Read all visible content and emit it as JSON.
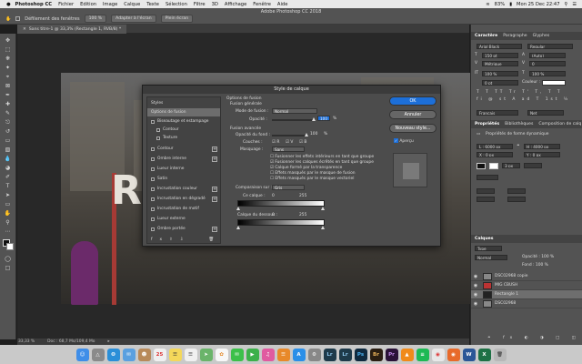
{
  "menubar": {
    "app": "Photoshop CC",
    "items": [
      "Fichier",
      "Edition",
      "Image",
      "Calque",
      "Texte",
      "Sélection",
      "Filtre",
      "3D",
      "Affichage",
      "Fenêtre",
      "Aide"
    ],
    "battery": "83%",
    "datetime": "Mon 25 Dec 22:47"
  },
  "optbar": {
    "window_title": "Adobe Photoshop CC 2018",
    "scroll_all_label": "Défilement des fenêtres",
    "zoom_value": "100 %",
    "fit_screen_label": "Adapter à l'écran",
    "full_screen_label": "Plein écran"
  },
  "document": {
    "tab_label": "Sans titre-1 @ 33,3% (Rectangle 1, RVB/8) *",
    "canvas_letter": "R"
  },
  "statusbar": {
    "zoom": "33,33 %",
    "doc_info": "Doc : 68,7 Mo/109,4 Mo"
  },
  "right_panel": {
    "tabs_top": [
      "Caractère",
      "Paragraphe",
      "Glyphes"
    ],
    "font_family": "Arial Black",
    "font_style": "Regular",
    "font_size": "150 pt",
    "leading": "(Auto)",
    "kerning": "Métrique",
    "tracking": "0",
    "scale_v": "100 %",
    "scale_h": "100 %",
    "baseline": "0 pt",
    "color_label": "Couleur :",
    "language": "Français",
    "aa_mode": "Net",
    "props_tabs": [
      "Propriétés",
      "Bibliothèques",
      "Composition de calq"
    ],
    "props_title": "Propriétés de forme dynamique",
    "width": "L : 6000 px",
    "height": "H : 4000 px",
    "x": "X : 0 px",
    "y": "Y : 0 px",
    "stroke": "3 px",
    "layers_title": "Calques",
    "layers_filter": "Type",
    "blend": "Normal",
    "opacity": "Opacité : 100 %",
    "fill": "Fond : 100 %",
    "layers": [
      {
        "name": "DSC02968 copie",
        "selected": false
      },
      {
        "name": "MIG CBUSH",
        "selected": false
      },
      {
        "name": "Rectangle 1",
        "selected": true
      },
      {
        "name": "DSC02968",
        "selected": false
      }
    ]
  },
  "dialog": {
    "title": "Style de calque",
    "styles_header": "Styles",
    "style_items": [
      {
        "label": "Options de fusion",
        "checkbox": false,
        "plus": false,
        "selected": true
      },
      {
        "label": "Biseautage et estampage",
        "checkbox": true,
        "plus": false,
        "selected": false
      },
      {
        "label": "Contour",
        "checkbox": true,
        "plus": false,
        "selected": false,
        "indent": true
      },
      {
        "label": "Texture",
        "checkbox": true,
        "plus": false,
        "selected": false,
        "indent": true
      },
      {
        "label": "Contour",
        "checkbox": true,
        "plus": true,
        "selected": false
      },
      {
        "label": "Ombre interne",
        "checkbox": true,
        "plus": true,
        "selected": false
      },
      {
        "label": "Lueur interne",
        "checkbox": true,
        "plus": false,
        "selected": false
      },
      {
        "label": "Satin",
        "checkbox": true,
        "plus": false,
        "selected": false
      },
      {
        "label": "Incrustation couleur",
        "checkbox": true,
        "plus": true,
        "selected": false
      },
      {
        "label": "Incrustation en dégradé",
        "checkbox": true,
        "plus": true,
        "selected": false
      },
      {
        "label": "Incrustation de motif",
        "checkbox": true,
        "plus": false,
        "selected": false
      },
      {
        "label": "Lueur externe",
        "checkbox": true,
        "plus": false,
        "selected": false
      },
      {
        "label": "Ombre portée",
        "checkbox": true,
        "plus": true,
        "selected": false
      }
    ],
    "fx_label": "fx",
    "section_blend": "Options de fusion",
    "section_general": "Fusion générale",
    "blend_mode_label": "Mode de fusion :",
    "blend_mode_value": "Normal",
    "opacity_label": "Opacité :",
    "opacity_value": "100",
    "opacity_fraction": 1.0,
    "percent": "%",
    "section_advanced": "Fusion avancée",
    "fill_opacity_label": "Opacité du fond :",
    "fill_opacity_value": "100",
    "channels_label": "Couches :",
    "channel_r": "R",
    "channel_g": "V",
    "channel_b": "B",
    "knockout_label": "Masquage :",
    "knockout_value": "Sans",
    "adv_options": [
      "Fusionner les effets intérieurs en tant que groupe",
      "Fusionner les calques écrêtés en tant que groupe",
      "Calque formé par la transparence",
      "Effets masqués par le masque de fusion",
      "Effets masqués par le masque vectoriel"
    ],
    "blend_if_label": "Comparaison sur :",
    "blend_if_value": "Gris",
    "this_layer_label": "Ce calque :",
    "this_layer_min": "0",
    "this_layer_max": "255",
    "underlying_label": "Calque du dessous :",
    "underlying_min": "0",
    "underlying_max": "255",
    "ok_label": "OK",
    "cancel_label": "Annuler",
    "new_style_label": "Nouveau style...",
    "preview_label": "Aperçu"
  },
  "dock_icons": [
    "finder-icon",
    "launchpad-icon",
    "safari-icon",
    "mail-icon",
    "contacts-icon",
    "calendar-icon",
    "notes-icon",
    "reminders-icon",
    "maps-icon",
    "photos-icon",
    "messages-icon",
    "facetime-icon",
    "itunes-icon",
    "ibooks-icon",
    "appstore-icon",
    "preferences-icon",
    "lightroom-icon",
    "lightroom-classic-icon",
    "photoshop-icon",
    "bridge-icon",
    "premiere-icon",
    "vlc-icon",
    "spotify-icon",
    "chrome-icon",
    "firefox-icon",
    "word-icon",
    "excel-icon",
    "trash-icon"
  ]
}
